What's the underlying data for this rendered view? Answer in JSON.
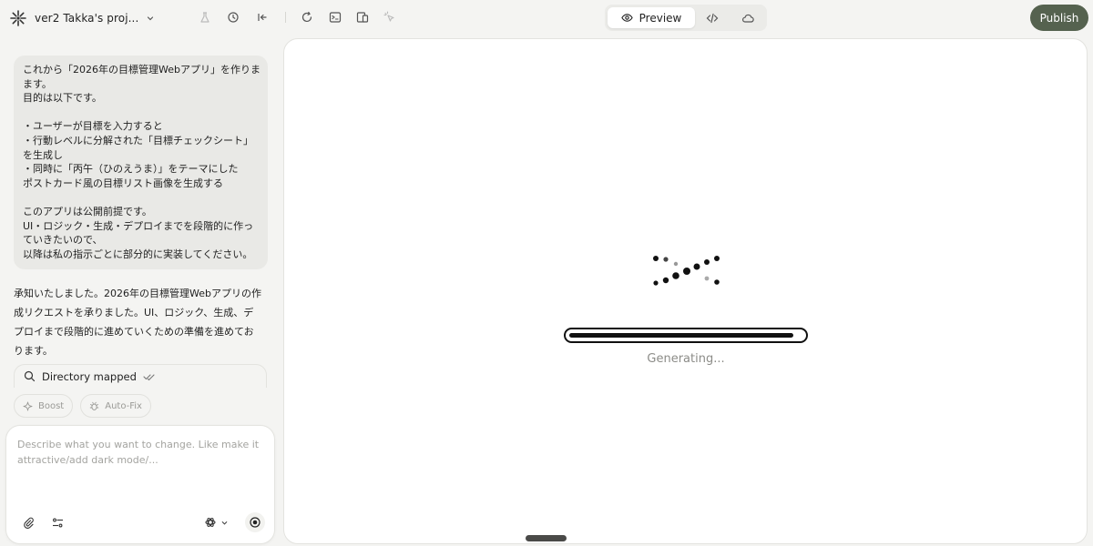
{
  "header": {
    "project_name": "ver2 Takka's proj...",
    "tabs": {
      "preview_label": "Preview"
    },
    "publish_label": "Publish"
  },
  "colors": {
    "publish_button": "#55624f",
    "background": "#f4f4f2",
    "bubble": "#e9e9e6"
  },
  "chat": {
    "user_message_lines": [
      "これから「2026年の目標管理Webアプリ」を作りま",
      "ます。",
      "目的は以下です。",
      "",
      "・ユーザーが目標を入力すると",
      "・行動レベルに分解された「目標チェックシート」",
      "を生成し",
      "・同時に「丙午（ひのえうま）」をテーマにした",
      "  ポストカード風の目標リスト画像を生成する",
      "",
      "このアプリは公開前提です。",
      "UI・ロジック・生成・デプロイまでを段階的に作っ",
      "ていきたいので、",
      "以降は私の指示ごとに部分的に実装してください。"
    ],
    "assistant_reply_lines": [
      "承知いたしました。2026年の目標管理Webアプリの作",
      "成リクエストを承りました。UI、ロジック、生成、デ",
      "プロイまで段階的に進めていくための準備を進めてお",
      "ります。"
    ],
    "status_item": "Directory mapped",
    "chips": {
      "boost": "Boost",
      "autofix": "Auto-Fix"
    },
    "composer": {
      "placeholder_lines": [
        "Describe what you want to change. Like make it",
        "attractive/add dark mode/..."
      ]
    }
  },
  "preview": {
    "status_text": "Generating...",
    "progress": 0.96
  }
}
